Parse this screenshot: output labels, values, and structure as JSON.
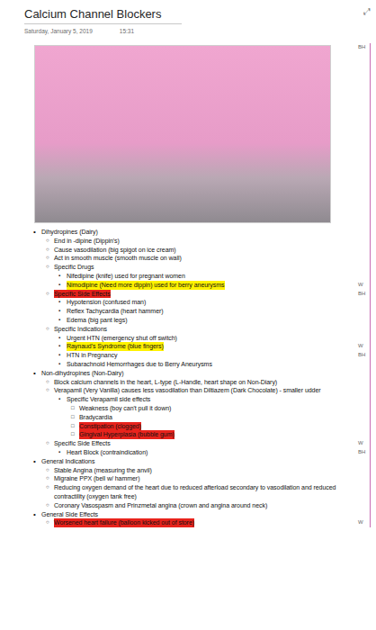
{
  "page": {
    "title": "Calcium Channel Blockers",
    "date": "Saturday, January 5, 2019",
    "time": "15:31",
    "expand_icon": "⤢"
  },
  "image": {
    "tag": "BH"
  },
  "outline": [
    {
      "bullet": "•",
      "depth": 0,
      "text": "Dihydropines (Dairy)",
      "highlighted": false
    },
    {
      "bullet": "○",
      "depth": 1,
      "text": "End in -dipine (Dippin's)",
      "highlighted": false
    },
    {
      "bullet": "○",
      "depth": 1,
      "text": "Cause vasodilation (big spigot on ice cream)",
      "highlighted": false
    },
    {
      "bullet": "○",
      "depth": 1,
      "text": "Act in smooth muscle (smooth muscle on wall)",
      "highlighted": false
    },
    {
      "bullet": "○",
      "depth": 1,
      "text": "Specific Drugs",
      "highlighted": false
    },
    {
      "bullet": "▪",
      "depth": 2,
      "text": "Nifedipine (knife) used for pregnant women",
      "highlighted": false
    },
    {
      "bullet": "▪",
      "depth": 2,
      "text": "Nimodipine (Need more dippin) used for berry aneurysms",
      "highlighted": true,
      "color": "#fff200",
      "tag": "W"
    },
    {
      "bullet": "○",
      "depth": 1,
      "text": "Specific Side Effects",
      "highlighted": true,
      "color": "#e8231c",
      "tag": "BH"
    },
    {
      "bullet": "▪",
      "depth": 2,
      "text": "Hypotension (confused man)",
      "highlighted": false
    },
    {
      "bullet": "▪",
      "depth": 2,
      "text": "Reflex Tachycardia (heart hammer)",
      "highlighted": false
    },
    {
      "bullet": "▪",
      "depth": 2,
      "text": "Edema (big pant legs)",
      "highlighted": false
    },
    {
      "bullet": "○",
      "depth": 1,
      "text": "Specific Indications",
      "highlighted": false
    },
    {
      "bullet": "▪",
      "depth": 2,
      "text": "Urgent HTN (emergency shut off switch)",
      "highlighted": false
    },
    {
      "bullet": "▪",
      "depth": 2,
      "text": "Raynaud's Syndrome (blue fingers)",
      "highlighted": true,
      "color": "#fff200",
      "tag": "W"
    },
    {
      "bullet": "▪",
      "depth": 2,
      "text": "HTN in Pregnancy",
      "highlighted": false,
      "tag": "BH"
    },
    {
      "bullet": "▪",
      "depth": 2,
      "text": "Subarachnoid Hemorrhages due to Berry Aneurysms",
      "highlighted": false
    },
    {
      "bullet": "•",
      "depth": 0,
      "text": "Non-dihydropines (Non-Dairy)",
      "highlighted": false
    },
    {
      "bullet": "○",
      "depth": 1,
      "text": "Block calcium channels in the heart, L-type (L-Handle, heart shape on Non-Diary)",
      "highlighted": false
    },
    {
      "bullet": "○",
      "depth": 1,
      "text": "Verapamil (Very Vanilla) causes less vasodilation than Diltiazem (Dark Chocolate) - smaller udder",
      "highlighted": false
    },
    {
      "bullet": "▪",
      "depth": 2,
      "text": "Specific Verapamil side effects",
      "highlighted": false
    },
    {
      "bullet": "□",
      "depth": 3,
      "text": "Weakness (boy can't pull it down)",
      "highlighted": false
    },
    {
      "bullet": "□",
      "depth": 3,
      "text": "Bradycardia",
      "highlighted": false
    },
    {
      "bullet": "□",
      "depth": 3,
      "text": "Constipation (clogged)",
      "highlighted": true,
      "color": "#e8231c"
    },
    {
      "bullet": "□",
      "depth": 3,
      "text": "Gingival Hyperplasia (bubble gum)",
      "highlighted": true,
      "color": "#e8231c"
    },
    {
      "bullet": "○",
      "depth": 1,
      "text": "Specific Side Effects",
      "highlighted": false,
      "tag": "W"
    },
    {
      "bullet": "▪",
      "depth": 2,
      "text": "Heart Block (contraindication)",
      "highlighted": false,
      "tag": "BH"
    },
    {
      "bullet": "•",
      "depth": 0,
      "text": "General Indications",
      "highlighted": false
    },
    {
      "bullet": "○",
      "depth": 1,
      "text": "Stable Angina (measuring the anvil)",
      "highlighted": false
    },
    {
      "bullet": "○",
      "depth": 1,
      "text": "Migraine PPX (bell w/ hammer)",
      "highlighted": false
    },
    {
      "bullet": "○",
      "depth": 1,
      "text": "Reducing oxygen demand of the heart due to reduced afterload secondary to vasodilation and reduced contractility (oxygen tank free)",
      "highlighted": false
    },
    {
      "bullet": "○",
      "depth": 1,
      "text": "Coronary Vasospasm and Prinzmetal angina (crown and angina around neck)",
      "highlighted": false
    },
    {
      "bullet": "•",
      "depth": 0,
      "text": "General Side Effects",
      "highlighted": false
    },
    {
      "bullet": "○",
      "depth": 1,
      "text": "Worsened heart failure (balloon kicked out of store)",
      "highlighted": true,
      "color": "#e8231c",
      "tag": "W"
    }
  ]
}
